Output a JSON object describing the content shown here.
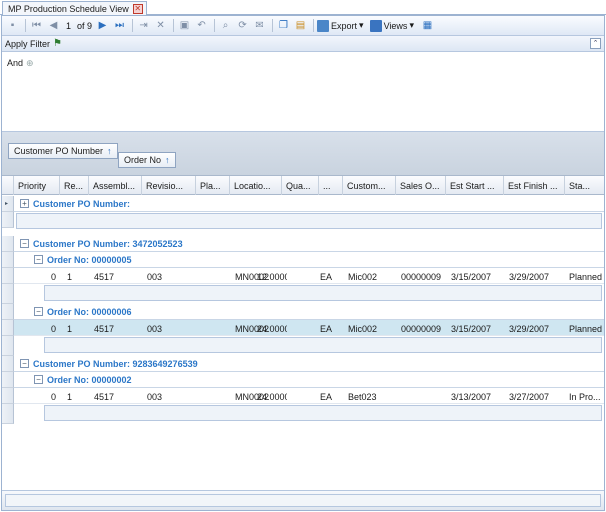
{
  "tab": {
    "title": "MP Production Schedule View",
    "close": "✕"
  },
  "toolbar": {
    "page_current": "1",
    "page_of": "of 9",
    "export_label": "Export",
    "views_label": "Views"
  },
  "filter": {
    "title": "Apply Filter",
    "collapse": "⌃",
    "logic": "And",
    "add": "⊕"
  },
  "groupby": {
    "level1": "Customer PO Number",
    "level2": "Order No",
    "arrow": "↑"
  },
  "columns": [
    "Priority",
    "Re...",
    "Assembl...",
    "Revisio...",
    "Pla...",
    "Locatio...",
    "Qua...",
    "...",
    "Custom...",
    "Sales O...",
    "Est Start ...",
    "Est Finish ...",
    "Sta..."
  ],
  "groups": [
    {
      "label": "Customer PO Number:",
      "collapsed_sign": "+",
      "orders": []
    },
    {
      "label": "Customer PO Number: 3472052523",
      "collapsed_sign": "−",
      "orders": [
        {
          "label": "Order No: 00000005",
          "sign": "−",
          "rows": [
            {
              "priority": "0",
              "re": "1",
              "assembly": "4517",
              "revision": "003",
              "plant": "",
              "location": "MN0002",
              "quantity": "12.0000",
              "unit": "EA",
              "customer": "Mic002",
              "sales_order": "00000009",
              "est_start": "3/15/2007",
              "est_finish": "3/29/2007",
              "status": "Planned"
            }
          ]
        },
        {
          "label": "Order No: 00000006",
          "sign": "−",
          "rows": [
            {
              "priority": "0",
              "re": "1",
              "assembly": "4517",
              "revision": "003",
              "plant": "",
              "location": "MN0002",
              "quantity": "24.0000",
              "unit": "EA",
              "customer": "Mic002",
              "sales_order": "00000009",
              "est_start": "3/15/2007",
              "est_finish": "3/29/2007",
              "status": "Planned"
            }
          ]
        }
      ]
    },
    {
      "label": "Customer PO Number: 9283649276539",
      "collapsed_sign": "−",
      "orders": [
        {
          "label": "Order No: 00000002",
          "sign": "−",
          "rows": [
            {
              "priority": "0",
              "re": "1",
              "assembly": "4517",
              "revision": "003",
              "plant": "",
              "location": "MN0002",
              "quantity": "24.0000",
              "unit": "EA",
              "customer": "Bet023",
              "sales_order": "",
              "est_start": "3/13/2007",
              "est_finish": "3/27/2007",
              "status": "In Pro..."
            }
          ]
        }
      ]
    }
  ],
  "colors": {
    "group_text": "#2b77c8",
    "selected_row": "#cfe6f1",
    "border": "#9db3d1"
  }
}
